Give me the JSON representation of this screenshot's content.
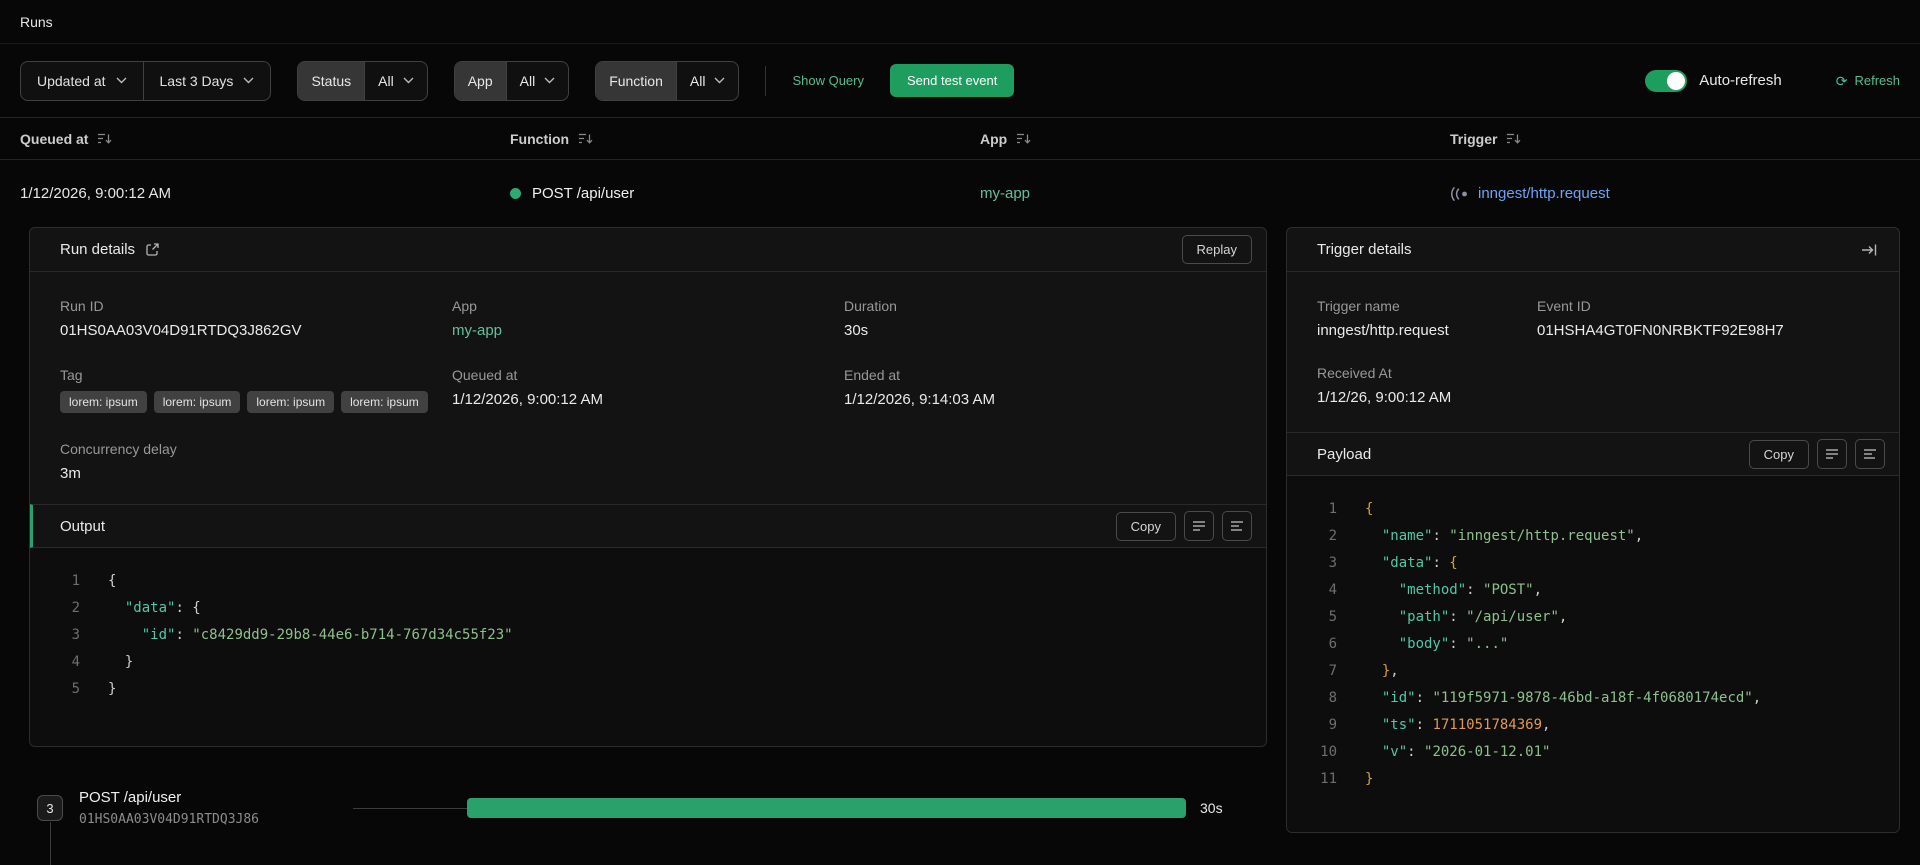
{
  "page": {
    "title": "Runs"
  },
  "colors": {
    "accent_green": "#1d9e5f",
    "progress_green": "#2aa06a",
    "link_green": "#55bd90",
    "app_link_green": "#5fc29a",
    "trigger_link_blue": "#6da2f7",
    "json_key": "#4ec9a8",
    "json_string": "#8dc08d",
    "json_number": "#df9a4f",
    "card_background": "#131313"
  },
  "icons": {
    "refresh": "⟳",
    "sort": "lines-arrow-down-icon",
    "external_link": "arrow-up-right-from-square-icon",
    "collapse_right": "arrow-to-bar-icon",
    "webhook": "signal-dot-icon"
  },
  "filters": {
    "updated_at": {
      "label": "Updated at"
    },
    "time_range": {
      "label": "Last 3 Days"
    },
    "status": {
      "label": "Status",
      "value": "All"
    },
    "app": {
      "label": "App",
      "value": "All"
    },
    "function": {
      "label": "Function",
      "value": "All"
    },
    "show_query": "Show Query",
    "send_test_event": "Send test event",
    "auto_refresh_label": "Auto-refresh",
    "refresh_label": "Refresh"
  },
  "table": {
    "columns": [
      "Queued at",
      "Function",
      "App",
      "Trigger"
    ],
    "row": {
      "queued_at": "1/12/2026, 9:00:12 AM",
      "function": "POST /api/user",
      "app": "my-app",
      "trigger": "inngest/http.request"
    }
  },
  "run_details": {
    "title": "Run details",
    "replay_label": "Replay",
    "fields": {
      "run_id": {
        "label": "Run ID",
        "value": "01HS0AA03V04D91RTDQ3J862GV"
      },
      "app": {
        "label": "App",
        "value": "my-app"
      },
      "duration": {
        "label": "Duration",
        "value": "30s"
      },
      "tag": {
        "label": "Tag",
        "values": [
          "lorem: ipsum",
          "lorem: ipsum",
          "lorem: ipsum",
          "lorem: ipsum"
        ]
      },
      "queued_at": {
        "label": "Queued at",
        "value": "1/12/2026, 9:00:12 AM"
      },
      "ended_at": {
        "label": "Ended at",
        "value": "1/12/2026, 9:14:03 AM"
      },
      "concurrency_delay": {
        "label": "Concurrency delay",
        "value": "3m"
      }
    },
    "output": {
      "title": "Output",
      "copy_label": "Copy",
      "code": [
        [
          [
            "p",
            "{"
          ]
        ],
        [
          [
            "p",
            "  "
          ],
          [
            "k",
            "\"data\""
          ],
          [
            "p",
            ": "
          ],
          [
            "p",
            "{"
          ]
        ],
        [
          [
            "p",
            "    "
          ],
          [
            "k",
            "\"id\""
          ],
          [
            "p",
            ": "
          ],
          [
            "s",
            "\"c8429dd9-29b8-44e6-b714-767d34c55f23\""
          ]
        ],
        [
          [
            "p",
            "  }"
          ]
        ],
        [
          [
            "p",
            "}"
          ]
        ]
      ]
    }
  },
  "timeline": {
    "step_count": "3",
    "step_name": "POST /api/user",
    "step_id": "01HS0AA03V04D91RTDQ3J86",
    "duration": "30s"
  },
  "trigger_details": {
    "title": "Trigger details",
    "fields": {
      "trigger_name": {
        "label": "Trigger name",
        "value": "inngest/http.request"
      },
      "event_id": {
        "label": "Event ID",
        "value": "01HSHA4GT0FN0NRBKTF92E98H7"
      },
      "received_at": {
        "label": "Received At",
        "value": "1/12/26, 9:00:12 AM"
      }
    },
    "payload": {
      "title": "Payload",
      "copy_label": "Copy",
      "code": [
        [
          [
            "b",
            "{"
          ]
        ],
        [
          [
            "p",
            "  "
          ],
          [
            "k",
            "\"name\""
          ],
          [
            "p",
            ": "
          ],
          [
            "s",
            "\"inngest/http.request\""
          ],
          [
            "p",
            ","
          ]
        ],
        [
          [
            "p",
            "  "
          ],
          [
            "k",
            "\"data\""
          ],
          [
            "p",
            ": "
          ],
          [
            "b",
            "{"
          ]
        ],
        [
          [
            "p",
            "    "
          ],
          [
            "k",
            "\"method\""
          ],
          [
            "p",
            ": "
          ],
          [
            "s",
            "\"POST\""
          ],
          [
            "p",
            ","
          ]
        ],
        [
          [
            "p",
            "    "
          ],
          [
            "k",
            "\"path\""
          ],
          [
            "p",
            ": "
          ],
          [
            "s",
            "\"/api/user\""
          ],
          [
            "p",
            ","
          ]
        ],
        [
          [
            "p",
            "    "
          ],
          [
            "k",
            "\"body\""
          ],
          [
            "p",
            ": "
          ],
          [
            "s",
            "\"...\""
          ]
        ],
        [
          [
            "p",
            "  "
          ],
          [
            "b",
            "}"
          ],
          [
            "p",
            ","
          ]
        ],
        [
          [
            "p",
            "  "
          ],
          [
            "k",
            "\"id\""
          ],
          [
            "p",
            ": "
          ],
          [
            "s",
            "\"119f5971-9878-46bd-a18f-4f0680174ecd\""
          ],
          [
            "p",
            ","
          ]
        ],
        [
          [
            "p",
            "  "
          ],
          [
            "k",
            "\"ts\""
          ],
          [
            "p",
            ": "
          ],
          [
            "n",
            "1711051784369"
          ],
          [
            "p",
            ","
          ]
        ],
        [
          [
            "p",
            "  "
          ],
          [
            "k",
            "\"v\""
          ],
          [
            "p",
            ": "
          ],
          [
            "s",
            "\"2026-01-12.01\""
          ]
        ],
        [
          [
            "b",
            "}"
          ]
        ]
      ]
    }
  }
}
